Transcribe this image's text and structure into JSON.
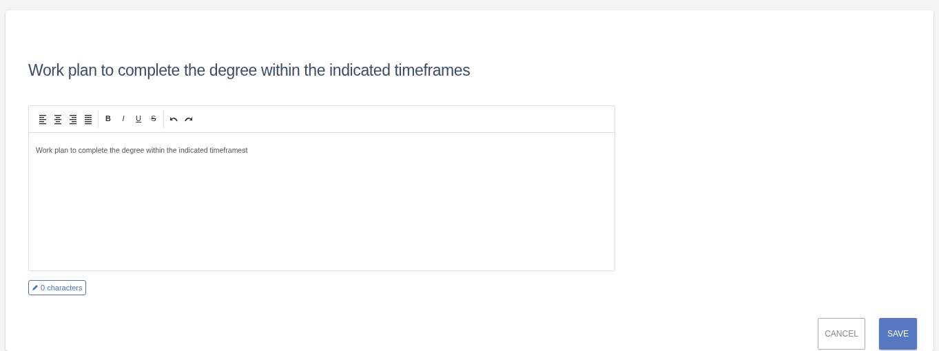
{
  "title": "Work plan to complete the degree within the indicated timeframes",
  "toolbar": [
    [
      {
        "kind": "align-left"
      },
      {
        "kind": "align-center"
      },
      {
        "kind": "align-right"
      },
      {
        "kind": "justify"
      }
    ],
    [
      {
        "kind": "bold",
        "label": "B"
      },
      {
        "kind": "italic",
        "label": "I"
      },
      {
        "kind": "underline",
        "label": "U"
      },
      {
        "kind": "strike",
        "label": "S"
      }
    ],
    [
      {
        "kind": "undo"
      },
      {
        "kind": "redo"
      }
    ]
  ],
  "editor": {
    "value": "Work plan to complete the degree within the indicated timeframest"
  },
  "counter": "0 characters",
  "buttons": [
    {
      "label": "CANCEL",
      "kind": "secondary"
    },
    {
      "label": "SAVE",
      "kind": "primary"
    }
  ]
}
